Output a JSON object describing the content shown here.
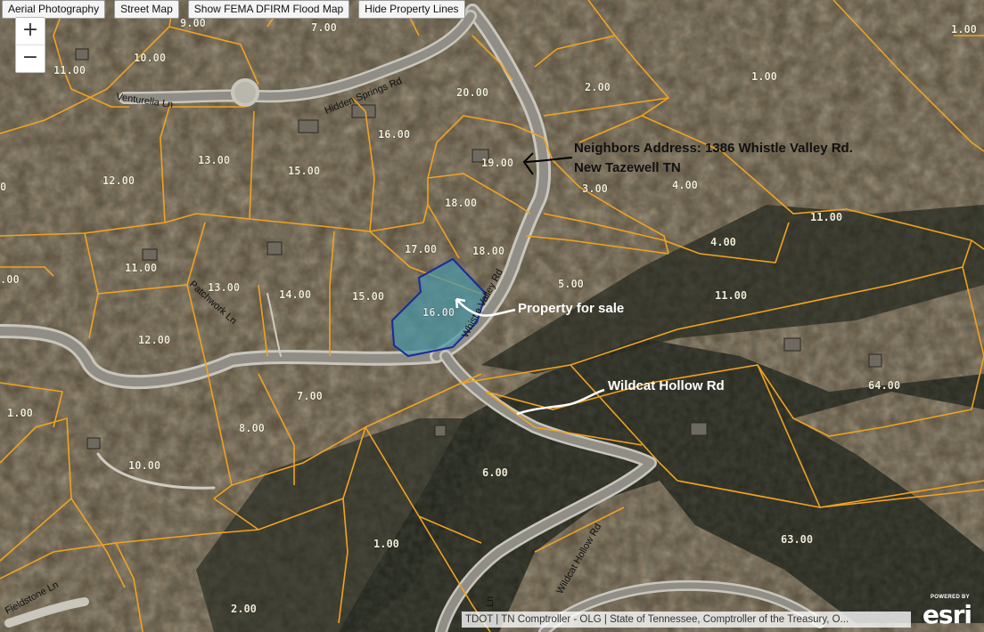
{
  "toolbar": {
    "aerial": "Aerial Photography",
    "street": "Street Map",
    "flood": "Show FEMA DFIRM Flood Map",
    "lines": "Hide Property Lines"
  },
  "zoom": {
    "in": "+",
    "out": "−"
  },
  "roads": {
    "venturella": "Venturella Ln",
    "hidden_springs": "Hidden Springs Rd",
    "whistle_valley": "Whistle Valley Rd",
    "patchwork": "Patchwork Ln",
    "wildcat_hollow": "Wildcat Hollow Rd",
    "fieldstone": "Fieldstone Ln",
    "partial_ln": "Ln"
  },
  "annotations": {
    "neighbors_line1": "Neighbors Address: 1386 Whistle Valley Rd.",
    "neighbors_line2": "New Tazewell TN",
    "property": "Property for sale",
    "wildcat": "Wildcat Hollow Rd"
  },
  "parcels": {
    "p900": "9.00",
    "p700": "7.00",
    "p1100a": "11.00",
    "p1000a": "10.00",
    "p2000": "20.00",
    "p200": "2.00",
    "p100a": "1.00",
    "p100b": "1.00",
    "p1600a": "16.00",
    "p1300a": "13.00",
    "p1500a": "15.00",
    "p1200a": "12.00",
    "p1900": "19.00",
    "p300": "3.00",
    "p400a": "4.00",
    "p1800a": "18.00",
    "p1100b": "11.00",
    "p1700": "17.00",
    "p1800b": "18.00",
    "p400b": "4.00",
    "p1100c": "11.00",
    "p1300b": "13.00",
    "p1400": "14.00",
    "p1500b": "15.00",
    "p1600b": "16.00",
    "p500": "5.00",
    "p1100d": "11.00",
    "p1200b": "12.00",
    "p700b": "7.00",
    "p6400": "64.00",
    "p100c": "1.00",
    "p800": "8.00",
    "p1000b": "10.00",
    "p600": "6.00",
    "p100d": "1.00",
    "p6300": "63.00",
    "p200b": "2.00",
    "pcut0": "0",
    "pcut1": ".00"
  },
  "attribution": "TDOT | TN Comptroller - OLG | State of Tennessee, Comptroller of the Treasury, O...",
  "branding": {
    "powered": "POWERED BY",
    "logo": "esri"
  },
  "colors": {
    "parcel_line": "#f2a21f",
    "selected_fill": "#4a97a8",
    "selected_stroke": "#1a2a9c"
  }
}
